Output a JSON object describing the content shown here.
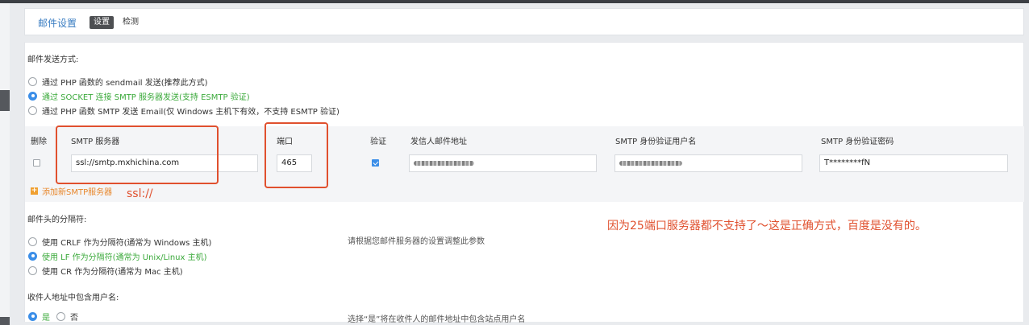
{
  "header": {
    "title": "邮件设置",
    "tabs": [
      {
        "label": "设置",
        "active": true
      },
      {
        "label": "检测",
        "active": false
      }
    ]
  },
  "send_method": {
    "title": "邮件发送方式:",
    "options": [
      {
        "label": "通过 PHP 函数的 sendmail 发送(推荐此方式)",
        "selected": false
      },
      {
        "label": "通过 SOCKET 连接 SMTP 服务器发送(支持 ESMTP 验证)",
        "selected": true
      },
      {
        "label": "通过 PHP 函数 SMTP 发送 Email(仅 Windows 主机下有效，不支持 ESMTP 验证)",
        "selected": false
      }
    ]
  },
  "smtp_table": {
    "headers": {
      "delete": "删除",
      "server": "SMTP 服务器",
      "port": "端口",
      "auth": "验证",
      "sender": "发信人邮件地址",
      "username": "SMTP 身份验证用户名",
      "password": "SMTP 身份验证密码"
    },
    "row": {
      "server": "ssl://smtp.mxhichina.com",
      "port": "465",
      "auth_checked": true,
      "password": "T********fN"
    },
    "add_label": "添加新SMTP服务器"
  },
  "separator": {
    "title": "邮件头的分隔符:",
    "hint": "请根据您邮件服务器的设置调整此参数",
    "options": [
      {
        "label": "使用 CRLF 作为分隔符(通常为 Windows 主机)",
        "selected": false
      },
      {
        "label": "使用 LF 作为分隔符(通常为 Unix/Linux 主机)",
        "selected": true
      },
      {
        "label": "使用 CR 作为分隔符(通常为 Mac 主机)",
        "selected": false
      }
    ]
  },
  "include_username": {
    "title": "收件人地址中包含用户名:",
    "hint": "选择“是”将在收件人的邮件地址中包含站点用户名",
    "options": [
      {
        "label": "是",
        "selected": true
      },
      {
        "label": "否",
        "selected": false
      }
    ]
  },
  "annotations": {
    "ssl": "ssl://",
    "note": "因为25端口服务器都不支持了～这是正确方式，百度是没有的。"
  },
  "colors": {
    "accent": "#3b8ee8",
    "annotation": "#e0502e",
    "selected_text": "#3aa93a",
    "add_link": "#e8862a"
  }
}
